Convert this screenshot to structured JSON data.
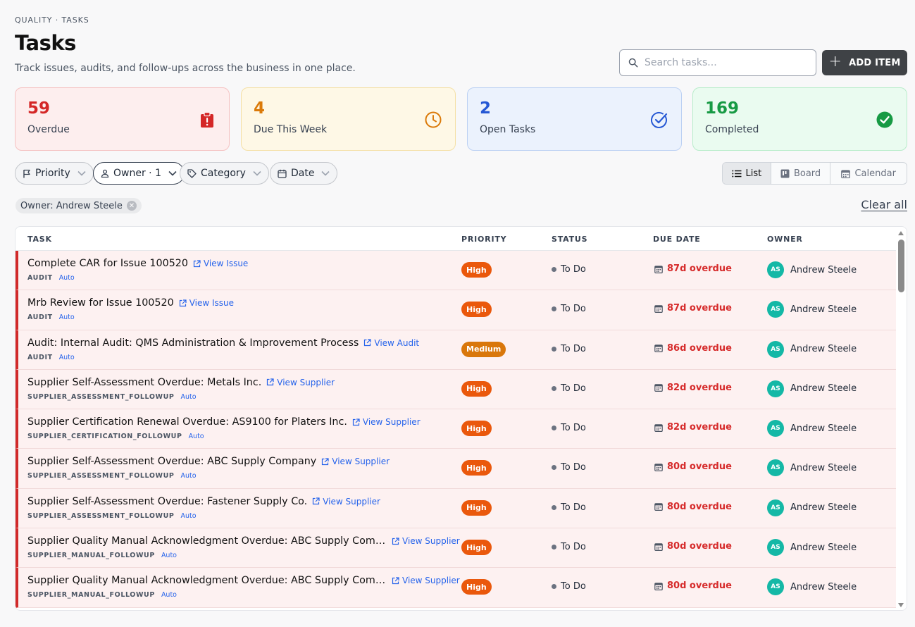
{
  "header": {
    "eyebrow": "QUALITY · TASKS",
    "title": "Tasks",
    "subtitle": "Track issues, audits, and follow-ups across the business in one place."
  },
  "search": {
    "placeholder": "Search tasks...",
    "value": ""
  },
  "add_button": {
    "label": "ADD ITEM"
  },
  "stats": [
    {
      "value": "59",
      "label": "Overdue",
      "icon": "alert-clipboard-icon",
      "color": "#d42727"
    },
    {
      "value": "4",
      "label": "Due This Week",
      "icon": "clock-icon",
      "color": "#db7a09"
    },
    {
      "value": "2",
      "label": "Open Tasks",
      "icon": "check-circle-outline-icon",
      "color": "#2558d4"
    },
    {
      "value": "169",
      "label": "Completed",
      "icon": "check-circle-filled-icon",
      "color": "#179a44"
    }
  ],
  "filters": [
    {
      "label": "Priority",
      "icon": "flag-icon"
    },
    {
      "label": "Owner · 1",
      "icon": "user-icon"
    },
    {
      "label": "Category",
      "icon": "tag-icon"
    },
    {
      "label": "Date",
      "icon": "calendar-icon"
    }
  ],
  "views": [
    {
      "label": "List",
      "icon": "list-icon",
      "selected": true
    },
    {
      "label": "Board",
      "icon": "board-icon",
      "selected": false
    },
    {
      "label": "Calendar",
      "icon": "calendar-icon",
      "selected": false
    }
  ],
  "active_filter": {
    "label": "Owner: Andrew Steele"
  },
  "clear_all": "Clear all",
  "table": {
    "columns": [
      "TASK",
      "PRIORITY",
      "STATUS",
      "DUE DATE",
      "OWNER"
    ],
    "rows": [
      {
        "title": "Complete CAR for Issue 100520",
        "link": "View Issue",
        "category": "AUDIT",
        "tag": "Auto",
        "priority": "High",
        "status": "To Do",
        "due": "87d overdue",
        "owner": "Andrew Steele",
        "initials": "AS"
      },
      {
        "title": "Mrb Review for Issue 100520",
        "link": "View Issue",
        "category": "AUDIT",
        "tag": "Auto",
        "priority": "High",
        "status": "To Do",
        "due": "87d overdue",
        "owner": "Andrew Steele",
        "initials": "AS"
      },
      {
        "title": "Audit: Internal Audit: QMS Administration & Improvement Process",
        "link": "View Audit",
        "category": "AUDIT",
        "tag": "Auto",
        "priority": "Medium",
        "status": "To Do",
        "due": "86d overdue",
        "owner": "Andrew Steele",
        "initials": "AS"
      },
      {
        "title": "Supplier Self-Assessment Overdue: Metals Inc.",
        "link": "View Supplier",
        "category": "SUPPLIER_ASSESSMENT_FOLLOWUP",
        "tag": "Auto",
        "priority": "High",
        "status": "To Do",
        "due": "82d overdue",
        "owner": "Andrew Steele",
        "initials": "AS"
      },
      {
        "title": "Supplier Certification Renewal Overdue: AS9100 for Platers Inc.",
        "link": "View Supplier",
        "category": "SUPPLIER_CERTIFICATION_FOLLOWUP",
        "tag": "Auto",
        "priority": "High",
        "status": "To Do",
        "due": "82d overdue",
        "owner": "Andrew Steele",
        "initials": "AS"
      },
      {
        "title": "Supplier Self-Assessment Overdue: ABC Supply Company",
        "link": "View Supplier",
        "category": "SUPPLIER_ASSESSMENT_FOLLOWUP",
        "tag": "Auto",
        "priority": "High",
        "status": "To Do",
        "due": "80d overdue",
        "owner": "Andrew Steele",
        "initials": "AS"
      },
      {
        "title": "Supplier Self-Assessment Overdue: Fastener Supply Co.",
        "link": "View Supplier",
        "category": "SUPPLIER_ASSESSMENT_FOLLOWUP",
        "tag": "Auto",
        "priority": "High",
        "status": "To Do",
        "due": "80d overdue",
        "owner": "Andrew Steele",
        "initials": "AS"
      },
      {
        "title": "Supplier Quality Manual Acknowledgment Overdue: ABC Supply Comp...",
        "link": "View Supplier",
        "category": "SUPPLIER_MANUAL_FOLLOWUP",
        "tag": "Auto",
        "priority": "High",
        "status": "To Do",
        "due": "80d overdue",
        "owner": "Andrew Steele",
        "initials": "AS"
      },
      {
        "title": "Supplier Quality Manual Acknowledgment Overdue: ABC Supply Comp...",
        "link": "View Supplier",
        "category": "SUPPLIER_MANUAL_FOLLOWUP",
        "tag": "Auto",
        "priority": "High",
        "status": "To Do",
        "due": "80d overdue",
        "owner": "Andrew Steele",
        "initials": "AS"
      }
    ]
  }
}
